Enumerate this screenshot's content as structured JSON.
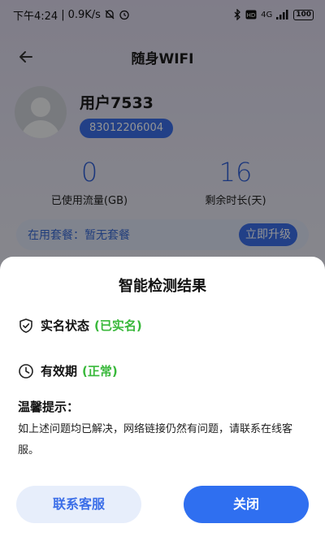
{
  "status_bar": {
    "time": "下午4:24",
    "speed": "0.9K/s",
    "signal": "4G",
    "battery": "100"
  },
  "header": {
    "title": "随身WIFI"
  },
  "profile": {
    "username": "用户7533",
    "device_id": "83012206004"
  },
  "stats": {
    "used": {
      "value": "0",
      "label": "已使用流量(GB)"
    },
    "remaining": {
      "value": "16",
      "label": "剩余时长(天)"
    }
  },
  "plan": {
    "text": "在用套餐：暂无套餐",
    "upgrade_label": "立即升级"
  },
  "dialog": {
    "title": "智能检测结果",
    "realname_label": "实名状态",
    "realname_status": "(已实名)",
    "validity_label": "有效期",
    "validity_status": "(正常)",
    "tips_title": "温馨提示：",
    "tips_body": "如上述问题均已解决，网络链接仍然有问题，请联系在线客服。",
    "contact_label": "联系客服",
    "close_label": "关闭"
  },
  "colors": {
    "accent": "#3b6ee8",
    "status_ok": "#38b83a"
  }
}
